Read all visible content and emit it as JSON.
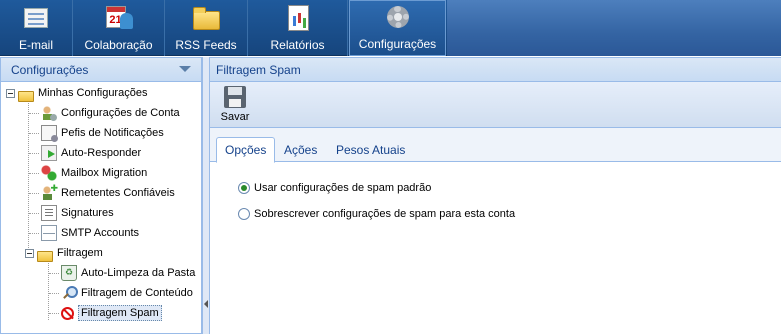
{
  "topbar": {
    "buttons": [
      {
        "label": "E-mail",
        "icon": "mail-icon"
      },
      {
        "label": "Colaboração",
        "icon": "calendar-people-icon",
        "calendar_day": "21"
      },
      {
        "label": "RSS Feeds",
        "icon": "folder-icon"
      },
      {
        "label": "Relatórios",
        "icon": "report-icon"
      },
      {
        "label": "Configurações",
        "icon": "gear-icon",
        "active": true
      }
    ]
  },
  "sidebar": {
    "title": "Configurações",
    "tree": {
      "root": "Minhas Configurações",
      "items": [
        {
          "label": "Configurações de Conta",
          "icon": "user-gear-icon"
        },
        {
          "label": "Pefis de Notificações",
          "icon": "notification-doc-icon"
        },
        {
          "label": "Auto-Responder",
          "icon": "auto-responder-icon"
        },
        {
          "label": "Mailbox Migration",
          "icon": "migration-icon"
        },
        {
          "label": "Remetentes Confiáveis",
          "icon": "trusted-sender-icon"
        },
        {
          "label": "Signatures",
          "icon": "signature-icon"
        },
        {
          "label": "SMTP Accounts",
          "icon": "envelope-icon"
        }
      ],
      "filter_folder": "Filtragem",
      "filter_items": [
        {
          "label": "Auto-Limpeza da Pasta",
          "icon": "trash-icon"
        },
        {
          "label": "Filtragem de Conteúdo",
          "icon": "magnifier-icon"
        },
        {
          "label": "Filtragem Spam",
          "icon": "ban-icon",
          "selected": true
        }
      ]
    }
  },
  "main": {
    "title": "Filtragem Spam",
    "toolbar": {
      "save_label": "Savar"
    },
    "tabs": [
      {
        "label": "Opções",
        "active": true
      },
      {
        "label": "Ações"
      },
      {
        "label": "Pesos Atuais"
      }
    ],
    "options": [
      {
        "label": "Usar configurações de spam padrão",
        "checked": true
      },
      {
        "label": "Sobrescrever configurações de spam para esta conta",
        "checked": false
      }
    ]
  },
  "colors": {
    "topbar": "#1f5a9c",
    "panel_header": "#c7dbf3",
    "border": "#99bbe8",
    "text": "#15428b"
  }
}
